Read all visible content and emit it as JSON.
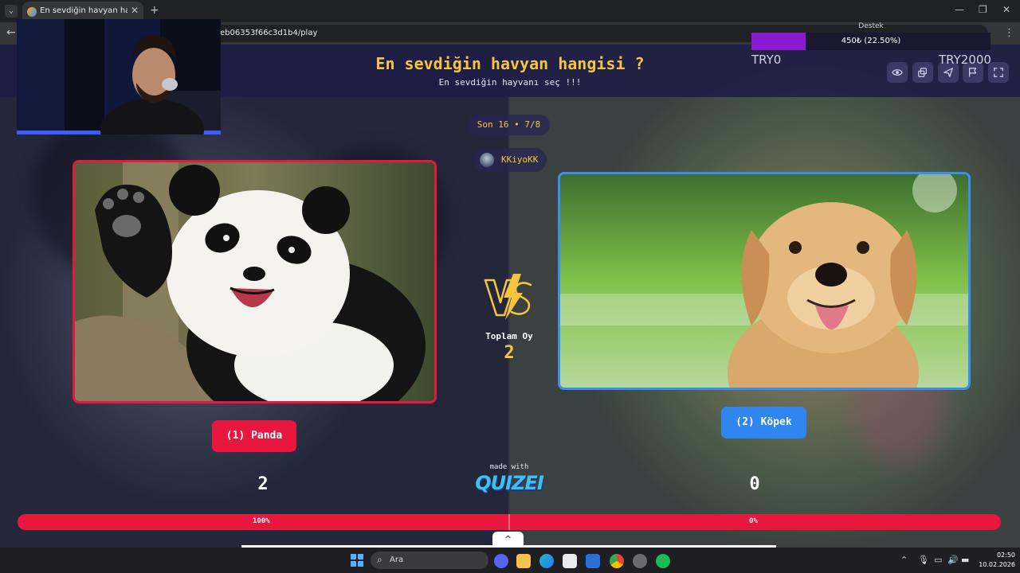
{
  "browser": {
    "tab_title": "En sevdiğin havyan hangisi ? - Q",
    "url": "eb06353f66c3d1b4/play",
    "tab_close": "✕",
    "new_tab": "+",
    "minimize": "—",
    "restore": "❐",
    "close": "✕",
    "back": "←",
    "menu": "⋮",
    "tab_list": "⌄"
  },
  "quiz": {
    "title": "En sevdiğin havyan hangisi ?",
    "subtitle": "En sevdiğin hayvanı seç !!!",
    "round": "Son 16 • 7/8",
    "user": "KKiyoKK",
    "total_label": "Toplam Oy",
    "total_votes": "2",
    "left": {
      "button": "(1) Panda",
      "votes": "2",
      "percent_label": "100%",
      "percent": 100,
      "accent": "#e8173d"
    },
    "right": {
      "button": "(2) Köpek",
      "votes": "0",
      "percent_label": "0%",
      "percent": 0,
      "accent": "#2f86f0"
    },
    "made_with": "made with",
    "logo": "QUIZEI",
    "collapse": "^"
  },
  "toolbar": {
    "icons": [
      "eye-icon",
      "share-icon",
      "send-icon",
      "flag-icon",
      "fullscreen-icon"
    ]
  },
  "donation": {
    "title": "Destek",
    "bar_text": "450₺ (22.50%)",
    "progress": 22.5,
    "min": "TRY0",
    "max": "TRY2000"
  },
  "taskbar": {
    "search_placeholder": "Ara",
    "search_icon": "⌕",
    "time": "02:50",
    "date": "10.02.2026",
    "tray_chevron": "⌃"
  },
  "colors": {
    "title": "#f5c542",
    "header": "#1e1c46",
    "red": "#e8173d",
    "blue": "#2f86f0"
  }
}
